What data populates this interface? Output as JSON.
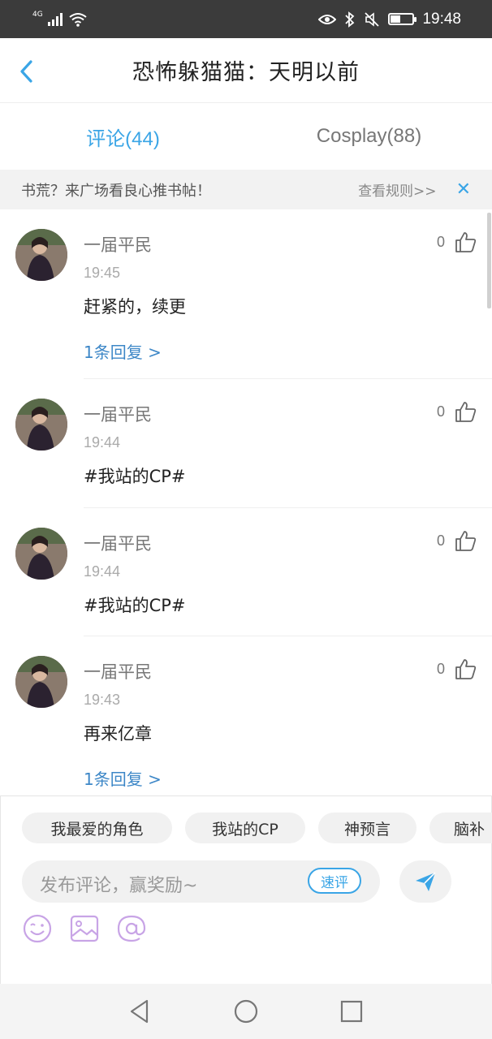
{
  "status_bar": {
    "network": "4G",
    "time": "19:48",
    "battery_level": 0.45
  },
  "header": {
    "title": "恐怖躲猫猫：天明以前"
  },
  "tabs": [
    {
      "label": "评论(44)",
      "active": true
    },
    {
      "label": "Cosplay(88)",
      "active": false
    }
  ],
  "banner": {
    "text": "书荒？来广场看良心推书帖！",
    "link": "查看规则>>",
    "close_icon": "close-icon"
  },
  "comments": [
    {
      "user": "一届平民",
      "time": "19:45",
      "content": "赶紧的，续更",
      "likes": "0",
      "reply": "1条回复 >"
    },
    {
      "user": "一届平民",
      "time": "19:44",
      "content": "#我站的CP#",
      "likes": "0",
      "reply": ""
    },
    {
      "user": "一届平民",
      "time": "19:44",
      "content": "#我站的CP#",
      "likes": "0",
      "reply": ""
    },
    {
      "user": "一届平民",
      "time": "19:43",
      "content": "再来亿章",
      "likes": "0",
      "reply": "1条回复 >"
    }
  ],
  "chips": [
    "我最爱的角色",
    "我站的CP",
    "神预言",
    "脑补"
  ],
  "composer": {
    "placeholder": "发布评论，赢奖励~",
    "speed_label": "速评",
    "send_icon": "send-icon"
  },
  "tools": [
    "emoji-icon",
    "image-icon",
    "mention-icon"
  ],
  "colors": {
    "accent": "#3aa5e6",
    "link": "#3d87c7",
    "tool_purple": "#c8a4e6",
    "status_bar": "#3b3b3b"
  }
}
